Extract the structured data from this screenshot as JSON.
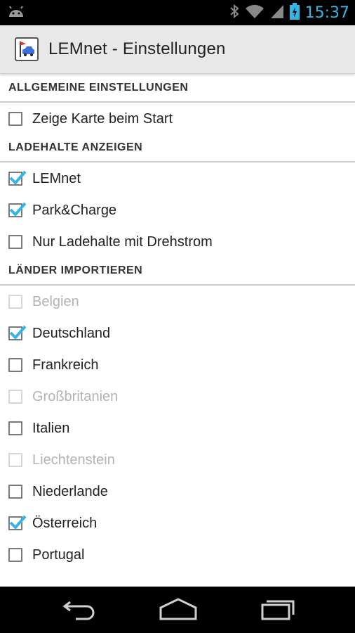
{
  "status_bar": {
    "time": "15:37",
    "icons": [
      "android-icon",
      "bluetooth-icon",
      "wifi-icon",
      "signal-icon",
      "battery-charging-icon"
    ],
    "accent_color": "#33b5e5"
  },
  "action_bar": {
    "title": "LEMnet - Einstellungen",
    "app_icon": "lemnet-app-icon"
  },
  "sections": [
    {
      "header": "ALLGEMEINE EINSTELLUNGEN",
      "items": [
        {
          "label": "Zeige Karte beim Start",
          "checked": false,
          "enabled": true
        }
      ]
    },
    {
      "header": "LADEHALTE ANZEIGEN",
      "items": [
        {
          "label": "LEMnet",
          "checked": true,
          "enabled": true
        },
        {
          "label": "Park&Charge",
          "checked": true,
          "enabled": true
        },
        {
          "label": "Nur Ladehalte mit Drehstrom",
          "checked": false,
          "enabled": true
        }
      ]
    },
    {
      "header": "LÄNDER IMPORTIEREN",
      "items": [
        {
          "label": "Belgien",
          "checked": false,
          "enabled": false
        },
        {
          "label": "Deutschland",
          "checked": true,
          "enabled": true
        },
        {
          "label": "Frankreich",
          "checked": false,
          "enabled": true
        },
        {
          "label": "Großbritanien",
          "checked": false,
          "enabled": false
        },
        {
          "label": "Italien",
          "checked": false,
          "enabled": true
        },
        {
          "label": "Liechtenstein",
          "checked": false,
          "enabled": false
        },
        {
          "label": "Niederlande",
          "checked": false,
          "enabled": true
        },
        {
          "label": "Österreich",
          "checked": true,
          "enabled": true
        },
        {
          "label": "Portugal",
          "checked": false,
          "enabled": true
        }
      ]
    }
  ],
  "nav_bar": {
    "buttons": [
      "back-icon",
      "home-icon",
      "recent-apps-icon"
    ]
  }
}
